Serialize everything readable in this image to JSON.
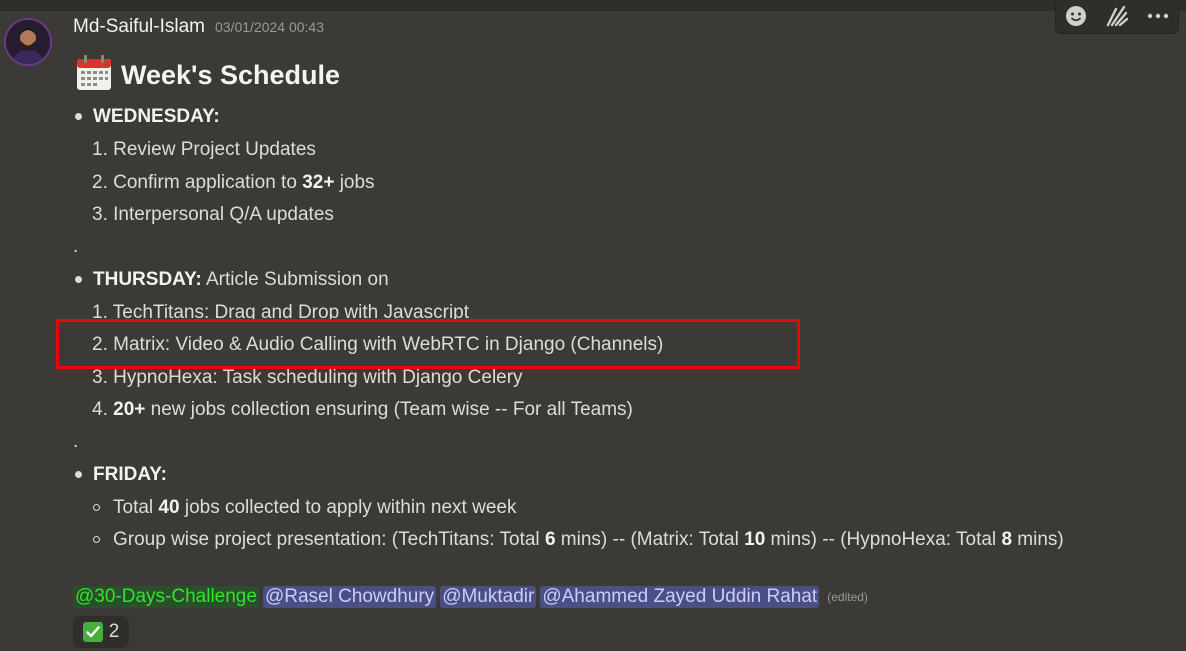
{
  "message": {
    "username": "Md-Saiful-Islam",
    "timestamp": "03/01/2024 00:43",
    "title": "Week's Schedule",
    "wednesday": {
      "heading": "WEDNESDAY:",
      "items": [
        {
          "number": "1.",
          "text": "Review Project Updates"
        },
        {
          "number": "2.",
          "pre": "Confirm application to ",
          "bold": "32+",
          "post": " jobs"
        },
        {
          "number": "3.",
          "text": "Interpersonal Q/A updates"
        }
      ]
    },
    "separator": ".",
    "thursday": {
      "heading": "THURSDAY:",
      "heading_suffix": " Article Submission on",
      "items": [
        {
          "number": "1.",
          "text": "TechTitans: Drag and Drop with Javascript"
        },
        {
          "number": "2.",
          "text": "Matrix: Video & Audio Calling with WebRTC in Django (Channels)"
        },
        {
          "number": "3.",
          "text": "HypnoHexa: Task scheduling with Django Celery"
        },
        {
          "number": "4.",
          "bold": "20+",
          "post": " new jobs collection ensuring (Team wise -- For all Teams)"
        }
      ]
    },
    "friday": {
      "heading": "FRIDAY:",
      "item1": {
        "pre": "Total ",
        "bold": "40",
        "post": " jobs collected to apply within next week"
      },
      "item2": {
        "p1": "Group wise project presentation: (TechTitans: Total ",
        "b1": "6",
        "p2": " mins) -- (Matrix: Total ",
        "b2": "10",
        "p3": " mins) -- (HypnoHexa: Total ",
        "b3": "8",
        "p4": " mins)"
      }
    },
    "mentions": [
      "@30-Days-Challenge",
      "@Rasel Chowdhury",
      "@Muktadir",
      "@Ahammed Zayed Uddin Rahat"
    ],
    "edited_label": "(edited)",
    "reaction": {
      "emoji": "check-mark",
      "count": "2"
    }
  },
  "colors": {
    "background": "#3b3a36",
    "highlight": "#e8060a",
    "mention_role": "#2ee52e",
    "mention_user": "#c9cdfb"
  },
  "icons": [
    "add-reaction-icon",
    "forum-icon",
    "more-options-icon",
    "calendar-icon",
    "check-mark-icon"
  ]
}
